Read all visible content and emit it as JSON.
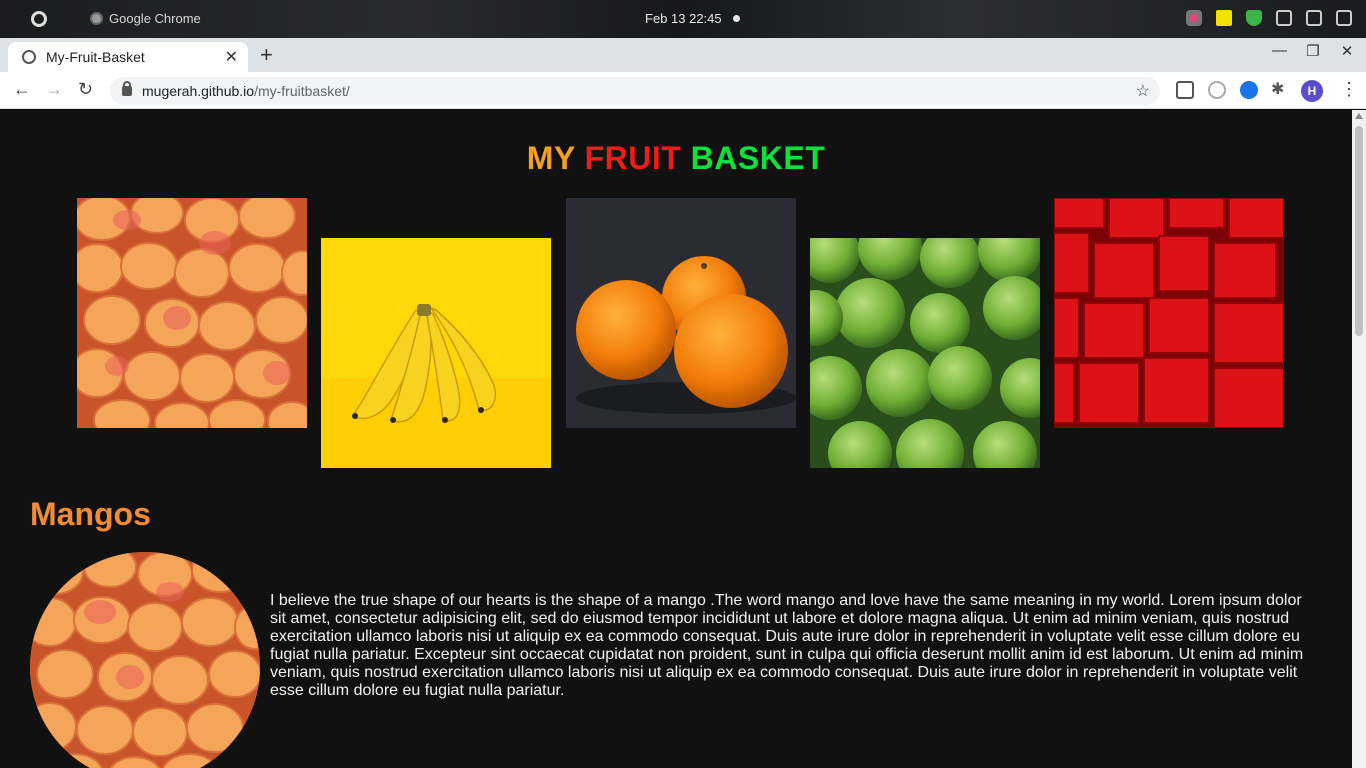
{
  "os": {
    "app_name": "Google Chrome",
    "clock": "Feb 13  22:45"
  },
  "browser": {
    "tab_title": "My-Fruit-Basket",
    "tab_close": "✕",
    "new_tab": "+",
    "url_domain": "mugerah.github.io",
    "url_path": "/my-fruitbasket/",
    "profile_initial": "H"
  },
  "page": {
    "title": {
      "my": "MY",
      "fruit": "FRUIT",
      "basket": "BASKET",
      "colors": {
        "my": "#f7a01e",
        "fruit": "#ef1c1c",
        "basket": "#0be23b"
      }
    },
    "gallery": [
      {
        "fruit": "mango",
        "color": "#e8733a"
      },
      {
        "fruit": "banana",
        "color": "#ffdd00"
      },
      {
        "fruit": "orange",
        "color": "#ff8c10"
      },
      {
        "fruit": "apple",
        "color": "#7dbb3a"
      },
      {
        "fruit": "watermelon",
        "color": "#d10c12"
      }
    ],
    "section": {
      "heading": "Mangos",
      "heading_color": "#f38b33",
      "body": "I believe the true shape of our hearts is the shape of a mango .The word mango and love have the same meaning in my world. Lorem ipsum dolor sit amet, consectetur adipisicing elit, sed do eiusmod tempor incididunt ut labore et dolore magna aliqua. Ut enim ad minim veniam, quis nostrud exercitation ullamco laboris nisi ut aliquip ex ea commodo consequat. Duis aute irure dolor in reprehenderit in voluptate velit esse cillum dolore eu fugiat nulla pariatur. Excepteur sint occaecat cupidatat non proident, sunt in culpa qui officia deserunt mollit anim id est laborum. Ut enim ad minim veniam, quis nostrud exercitation ullamco laboris nisi ut aliquip ex ea commodo consequat. Duis aute irure dolor in reprehenderit in voluptate velit esse cillum dolore eu fugiat nulla pariatur."
    }
  }
}
